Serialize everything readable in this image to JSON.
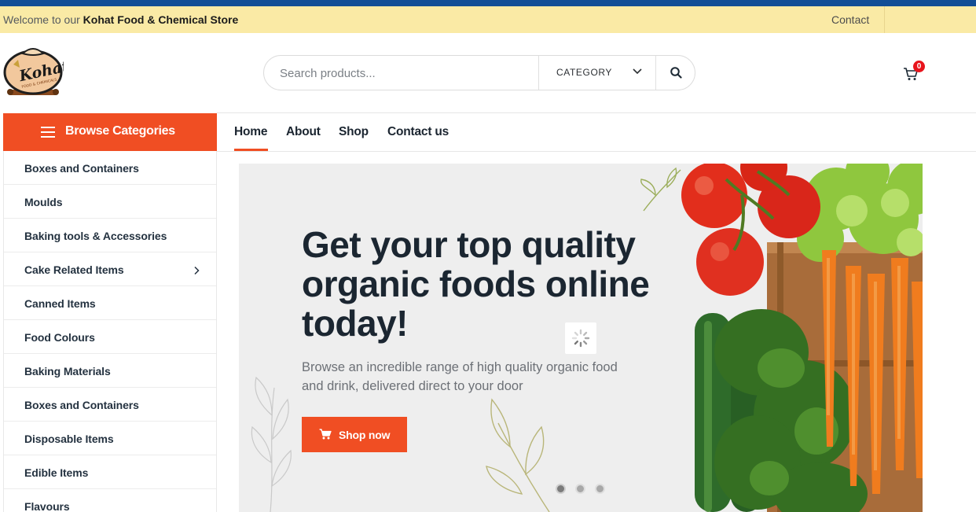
{
  "topbar": {
    "welcome_prefix": "Welcome to our",
    "store_name": "Kohat Food & Chemical Store",
    "contact": "Contact"
  },
  "logo": {
    "brand": "Kohat",
    "tagline": "FOOD & CHEMICALS"
  },
  "search": {
    "placeholder": "Search products...",
    "category_label": "CATEGORY"
  },
  "cart": {
    "count": "0"
  },
  "sidebar": {
    "title": "Browse Categories",
    "items": [
      {
        "label": "Boxes and Containers"
      },
      {
        "label": "Moulds"
      },
      {
        "label": "Baking tools & Accessories"
      },
      {
        "label": "Cake Related Items"
      },
      {
        "label": "Canned Items"
      },
      {
        "label": "Food Colours"
      },
      {
        "label": "Baking Materials"
      },
      {
        "label": "Boxes and Containers"
      },
      {
        "label": "Disposable Items"
      },
      {
        "label": "Edible Items"
      },
      {
        "label": "Flavours"
      }
    ]
  },
  "nav": {
    "items": [
      {
        "label": "Home"
      },
      {
        "label": "About"
      },
      {
        "label": "Shop"
      },
      {
        "label": "Contact us"
      }
    ],
    "active": "Home"
  },
  "banner": {
    "title": "Get your top quality organic foods online today!",
    "subtitle": "Browse an incredible range of high quality organic food and drink, delivered direct to your door",
    "button_label": "Shop now",
    "slides": 3,
    "active_slide": 1
  },
  "colors": {
    "accent": "#f04e23",
    "topbar_bg": "#faeaa5",
    "top_strip": "#124e96",
    "badge": "#e8141c"
  }
}
